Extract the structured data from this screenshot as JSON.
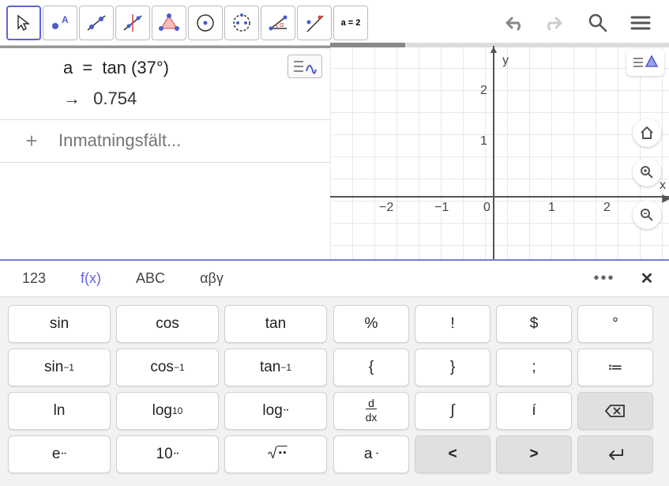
{
  "algebra": {
    "expression_lhs": "a",
    "expression_eq": "=",
    "expression_rhs": "tan (37°)",
    "result_arrow": "→",
    "result_value": "0.754",
    "input_placeholder": "Inmatningsfält...",
    "plus": "+"
  },
  "graphics": {
    "y_label": "y",
    "x_label": "x",
    "ticks_x": [
      "−2",
      "−1",
      "0",
      "1",
      "2"
    ],
    "ticks_y": [
      "1",
      "2"
    ]
  },
  "keyboard": {
    "tabs": [
      "123",
      "f(x)",
      "ABC",
      "αβγ"
    ],
    "more": "•••",
    "close": "✕",
    "left": [
      [
        "sin",
        "cos",
        "tan"
      ],
      [
        "sin⁻¹",
        "cos⁻¹",
        "tan⁻¹"
      ],
      [
        "ln",
        "log10",
        "log_"
      ],
      [
        "e^",
        "10^",
        "nroot"
      ]
    ],
    "right": [
      [
        "%",
        "!",
        "$",
        "°"
      ],
      [
        "{",
        "}",
        ";",
        "≔"
      ],
      [
        "d/dx",
        "∫",
        "í",
        "backspace"
      ],
      [
        "a_",
        "<",
        ">",
        "enter"
      ]
    ]
  },
  "tools": {
    "a_eq_2": "a = 2"
  }
}
